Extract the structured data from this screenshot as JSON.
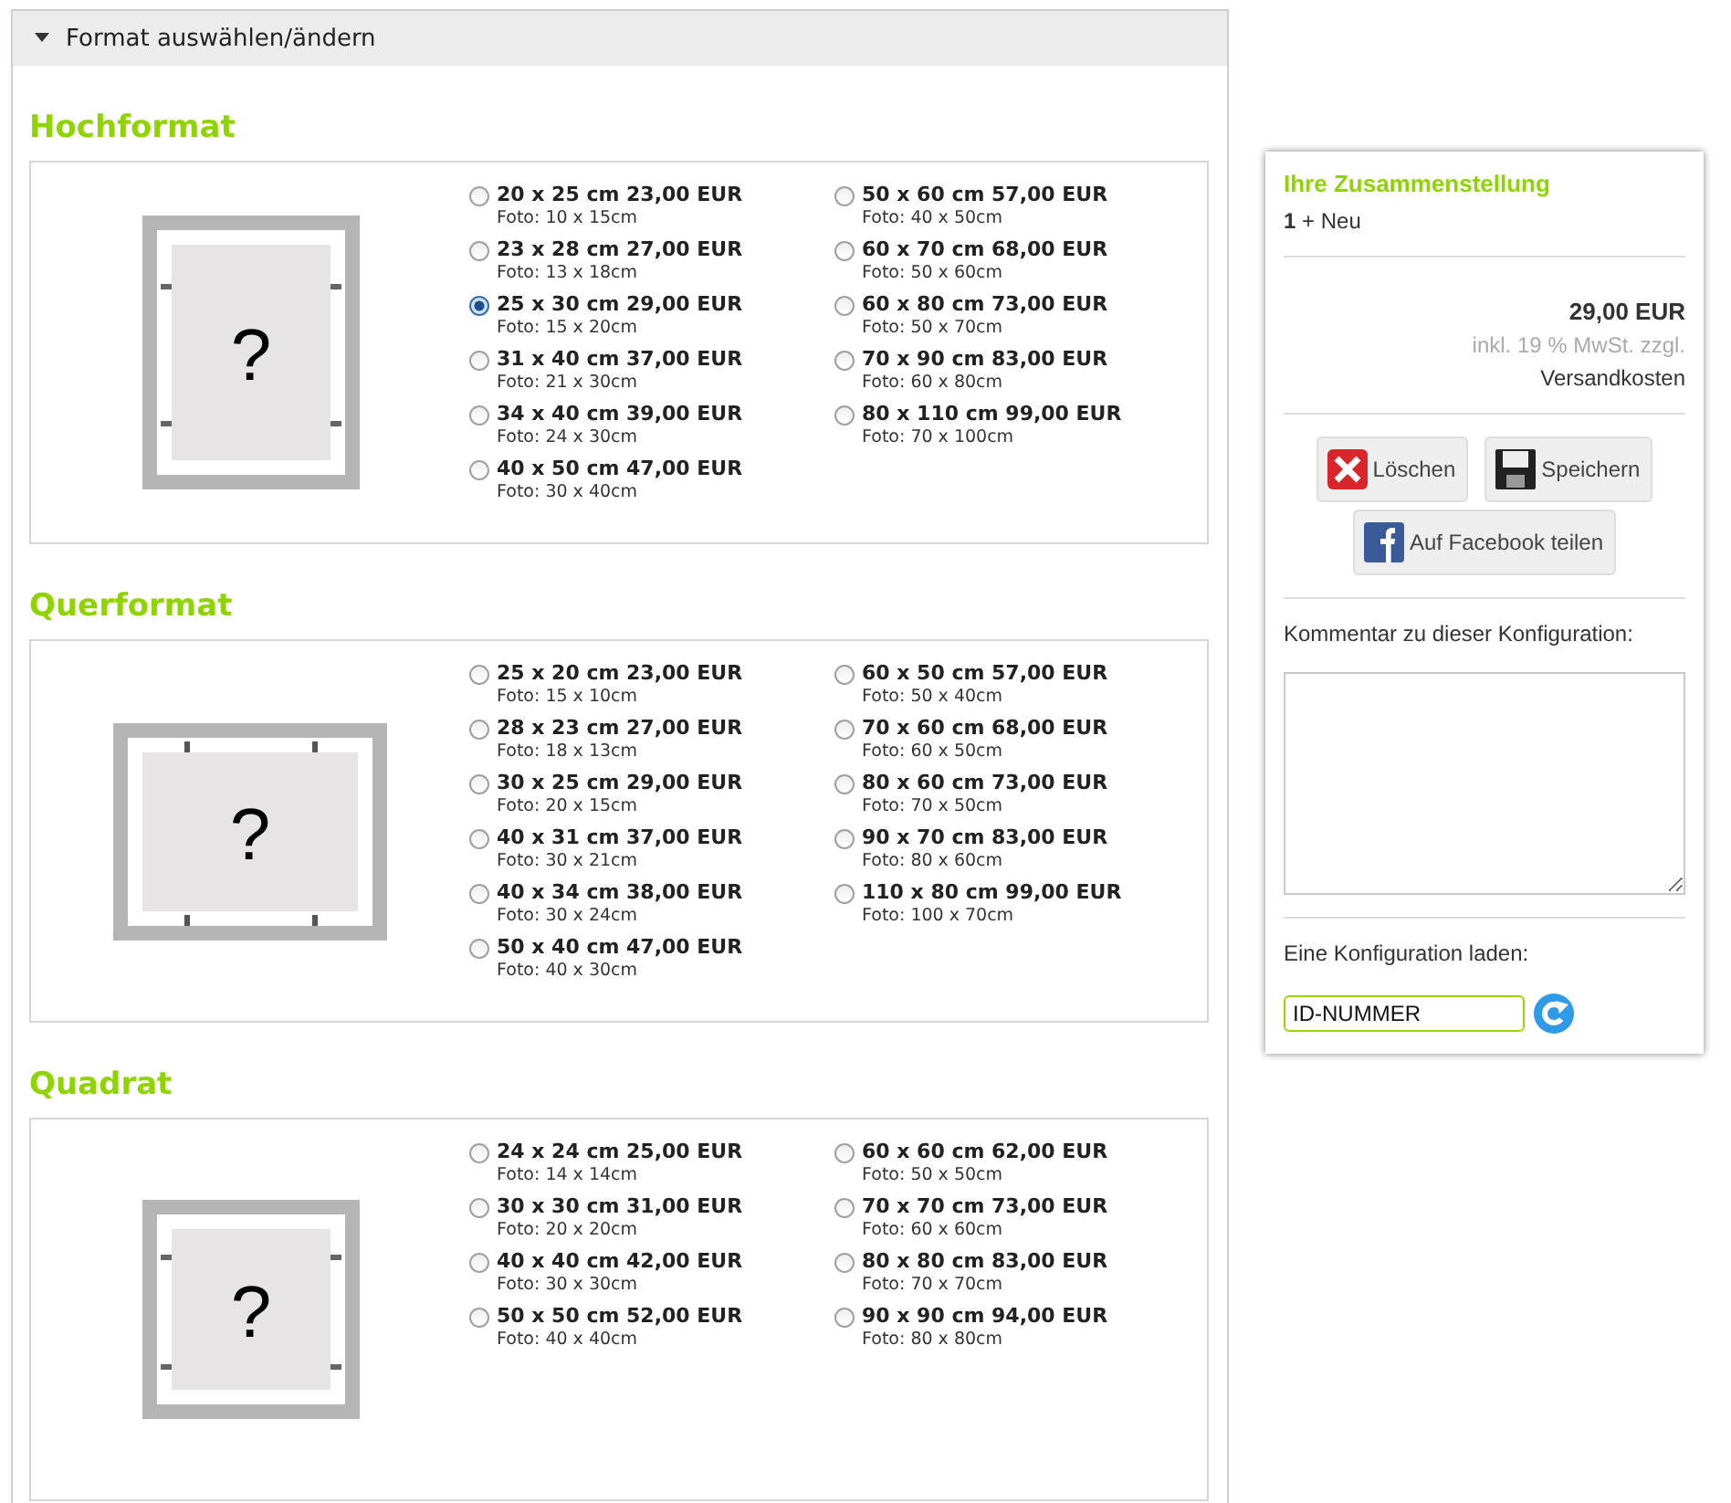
{
  "accordion": {
    "title": "Format auswählen/ändern",
    "expanded": true
  },
  "sections": [
    {
      "title": "Hochformat",
      "kind": "portrait",
      "image_mark": "?",
      "options": [
        {
          "label": "20 x 25 cm 23,00 EUR",
          "foto": "Foto: 10 x 15cm",
          "selected": false
        },
        {
          "label": "23 x 28 cm 27,00 EUR",
          "foto": "Foto: 13 x 18cm",
          "selected": false
        },
        {
          "label": "25 x 30 cm 29,00 EUR",
          "foto": "Foto: 15 x 20cm",
          "selected": true
        },
        {
          "label": "31 x 40 cm 37,00 EUR",
          "foto": "Foto: 21 x 30cm",
          "selected": false
        },
        {
          "label": "34 x 40 cm 39,00 EUR",
          "foto": "Foto: 24 x 30cm",
          "selected": false
        },
        {
          "label": "40 x 50 cm 47,00 EUR",
          "foto": "Foto: 30 x 40cm",
          "selected": false
        },
        {
          "label": "50 x 60 cm 57,00 EUR",
          "foto": "Foto: 40 x 50cm",
          "selected": false
        },
        {
          "label": "60 x 70 cm 68,00 EUR",
          "foto": "Foto: 50 x 60cm",
          "selected": false
        },
        {
          "label": "60 x 80 cm 73,00 EUR",
          "foto": "Foto: 50 x 70cm",
          "selected": false
        },
        {
          "label": "70 x 90 cm 83,00 EUR",
          "foto": "Foto: 60 x 80cm",
          "selected": false
        },
        {
          "label": "80 x 110 cm 99,00 EUR",
          "foto": "Foto: 70 x 100cm",
          "selected": false
        }
      ]
    },
    {
      "title": "Querformat",
      "kind": "landscape",
      "image_mark": "?",
      "options": [
        {
          "label": "25 x 20 cm 23,00 EUR",
          "foto": "Foto: 15 x 10cm",
          "selected": false
        },
        {
          "label": "28 x 23 cm 27,00 EUR",
          "foto": "Foto: 18 x 13cm",
          "selected": false
        },
        {
          "label": "30 x 25 cm 29,00 EUR",
          "foto": "Foto: 20 x 15cm",
          "selected": false
        },
        {
          "label": "40 x 31 cm 37,00 EUR",
          "foto": "Foto: 30 x 21cm",
          "selected": false
        },
        {
          "label": "40 x 34 cm 38,00 EUR",
          "foto": "Foto: 30 x 24cm",
          "selected": false
        },
        {
          "label": "50 x 40 cm 47,00 EUR",
          "foto": "Foto: 40 x 30cm",
          "selected": false
        },
        {
          "label": "60 x 50 cm 57,00 EUR",
          "foto": "Foto: 50 x 40cm",
          "selected": false
        },
        {
          "label": "70 x 60 cm 68,00 EUR",
          "foto": "Foto: 60 x 50cm",
          "selected": false
        },
        {
          "label": "80 x 60 cm 73,00 EUR",
          "foto": "Foto: 70 x 50cm",
          "selected": false
        },
        {
          "label": "90 x 70 cm 83,00 EUR",
          "foto": "Foto: 80 x 60cm",
          "selected": false
        },
        {
          "label": "110 x 80 cm 99,00 EUR",
          "foto": "Foto: 100 x 70cm",
          "selected": false
        }
      ]
    },
    {
      "title": "Quadrat",
      "kind": "square",
      "image_mark": "?",
      "options": [
        {
          "label": "24 x 24 cm 25,00 EUR",
          "foto": "Foto: 14 x 14cm",
          "selected": false
        },
        {
          "label": "30 x 30 cm 31,00 EUR",
          "foto": "Foto: 20 x 20cm",
          "selected": false
        },
        {
          "label": "40 x 40 cm 42,00 EUR",
          "foto": "Foto: 30 x 30cm",
          "selected": false
        },
        {
          "label": "50 x 50 cm 52,00 EUR",
          "foto": "Foto: 40 x 40cm",
          "selected": false
        },
        {
          "label": "60 x 60 cm 62,00 EUR",
          "foto": "Foto: 50 x 50cm",
          "selected": false
        },
        {
          "label": "70 x 70 cm 73,00 EUR",
          "foto": "Foto: 60 x 60cm",
          "selected": false
        },
        {
          "label": "80 x 80 cm 83,00 EUR",
          "foto": "Foto: 70 x 70cm",
          "selected": false
        },
        {
          "label": "90 x 90 cm 94,00 EUR",
          "foto": "Foto: 80 x 80cm",
          "selected": false
        }
      ]
    }
  ],
  "summary": {
    "title": "Ihre Zusammenstellung",
    "items": "**1** + Neu",
    "price": "29,00 EUR",
    "tax_note": "inkl. 19 % MwSt. zzgl.",
    "shipping": "Versandkosten",
    "buttons": [
      {
        "kind": "delete",
        "label": "Löschen"
      },
      {
        "kind": "save",
        "label": "Speichern"
      },
      {
        "kind": "facebook",
        "label": "Auf Facebook teilen"
      }
    ],
    "comment_label": "Kommentar zu dieser Konfiguration:",
    "load_label": "Eine Konfiguration laden:",
    "id_value": "ID-NUMMER"
  }
}
